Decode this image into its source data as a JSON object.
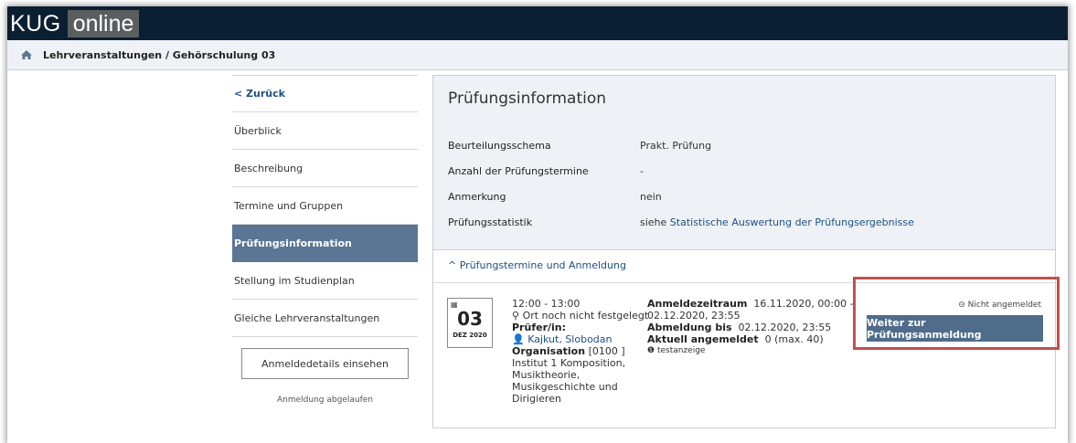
{
  "header": {
    "logo_kug": "KUG",
    "logo_online": "online"
  },
  "breadcrumb": {
    "icon": "home-icon",
    "text": "Lehrveranstaltungen / Gehörschulung 03"
  },
  "sidebar": {
    "back_label": "< Zurück",
    "items": [
      {
        "label": "Überblick"
      },
      {
        "label": "Beschreibung"
      },
      {
        "label": "Termine und Gruppen"
      },
      {
        "label": "Prüfungsinformation",
        "active": true
      },
      {
        "label": "Stellung im Studienplan"
      },
      {
        "label": "Gleiche Lehrveranstaltungen"
      }
    ],
    "details_button": "Anmeldedetails einsehen",
    "note": "Anmeldung abgelaufen"
  },
  "panel": {
    "title": "Prüfungsinformation",
    "rows": [
      {
        "label": "Beurteilungsschema",
        "value": "Prakt. Prüfung"
      },
      {
        "label": "Anzahl der Prüfungstermine",
        "value": "-"
      },
      {
        "label": "Anmerkung",
        "value": "nein"
      },
      {
        "label": "Prüfungsstatistik",
        "value_prefix": "siehe ",
        "value_link": "Statistische Auswertung der Prüfungsergebnisse"
      }
    ],
    "accordion_label": "^ Prüfungstermine und Anmeldung"
  },
  "exam": {
    "day": "03",
    "month": "DEZ 2020",
    "time": "12:00 - 13:00",
    "location": "Ort noch nicht festgelegt",
    "examiner_label": "Prüfer/in:",
    "examiner": "Kajkut, Slobodan",
    "org_label": "Organisation",
    "org_value": "[0100 ] Institut 1 Komposition, Musiktheorie, Musikgeschichte und Dirigieren",
    "reg_period_label": "Anmeldezeitraum",
    "reg_period_value": "16.11.2020, 00:00 - 02.12.2020, 23:55",
    "dereg_label": "Abmeldung bis",
    "dereg_value": "02.12.2020, 23:55",
    "current_label": "Aktuell angemeldet",
    "current_value": "0 (max. 40)",
    "info_note": "testanzeige",
    "status": "Nicht angemeldet",
    "cta": "Weiter zur Prüfungsanmeldung"
  },
  "colors": {
    "topbar": "#0b1f33",
    "active": "#5b7695",
    "button": "#4f6c8b",
    "highlight": "#c0504d",
    "link": "#1d4f85"
  }
}
